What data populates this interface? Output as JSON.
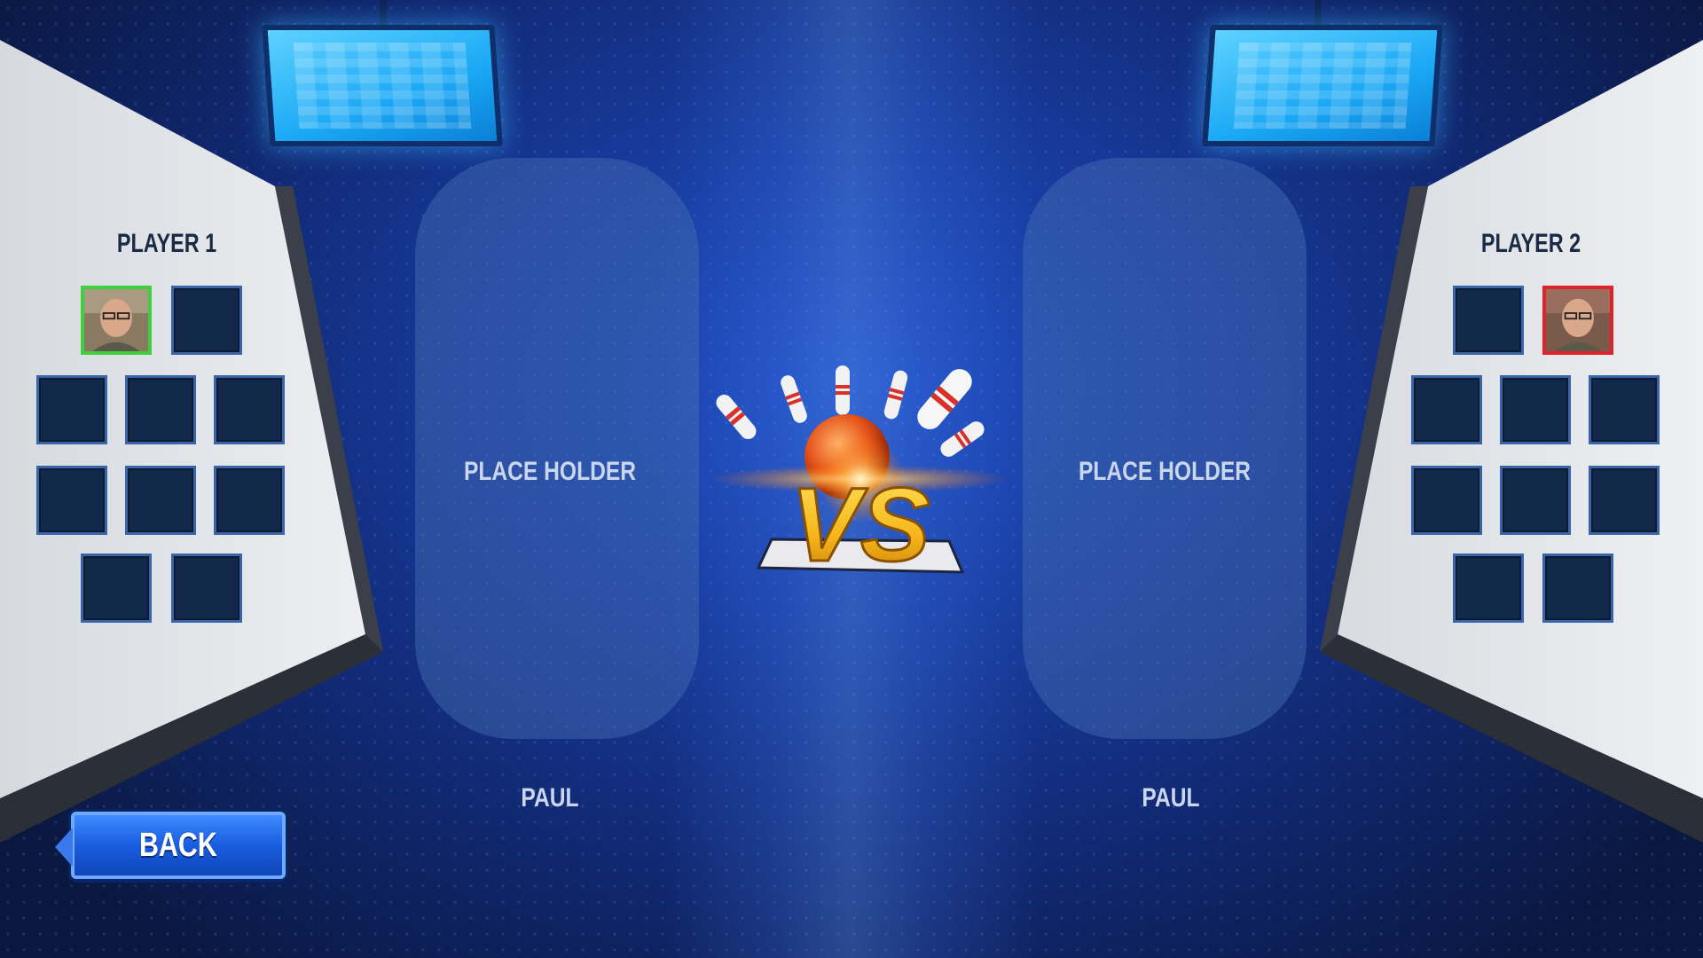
{
  "players": [
    {
      "title": "PLAYER 1",
      "card_text": "PLACE HOLDER",
      "name": "PAUL",
      "selected_color": "#3ed13b"
    },
    {
      "title": "PLAYER 2",
      "card_text": "PLACE HOLDER",
      "name": "PAUL",
      "selected_color": "#e0232a"
    }
  ],
  "vs_label": "VS",
  "back_button": {
    "label": "BACK"
  },
  "colors": {
    "bg_center": "#1f4fc4",
    "bg_edge": "#0a173f",
    "slot_fill": "#13294a",
    "slot_border": "#3a64a8",
    "vs_gold": "#f5b51a"
  }
}
